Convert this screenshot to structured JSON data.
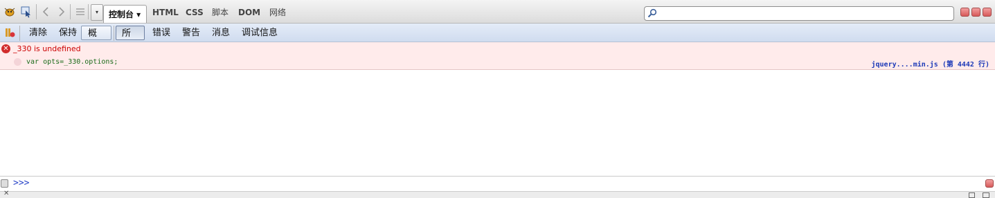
{
  "toolbar": {
    "panel_dropdown_label": "控制台 ▾",
    "tabs": [
      "HTML",
      "CSS",
      "脚本",
      "DOM",
      "网络"
    ],
    "search_placeholder": "",
    "search_value": ""
  },
  "filterbar": {
    "buttons": [
      "清除",
      "保持",
      "概况"
    ],
    "filters": [
      "所有",
      "错误",
      "警告",
      "消息",
      "调试信息"
    ]
  },
  "console": {
    "entries": [
      {
        "type": "error",
        "message": "_330 is undefined",
        "source_code": "var opts=_330.options;",
        "file_link": "jquery....min.js (第 4442 行)"
      }
    ]
  },
  "commandline": {
    "prompt": ">>>",
    "value": ""
  },
  "colors": {
    "error_bg": "#ffebeb",
    "error_text": "#cc0000",
    "link": "#1d3ab8",
    "prompt": "#2a45c8"
  }
}
